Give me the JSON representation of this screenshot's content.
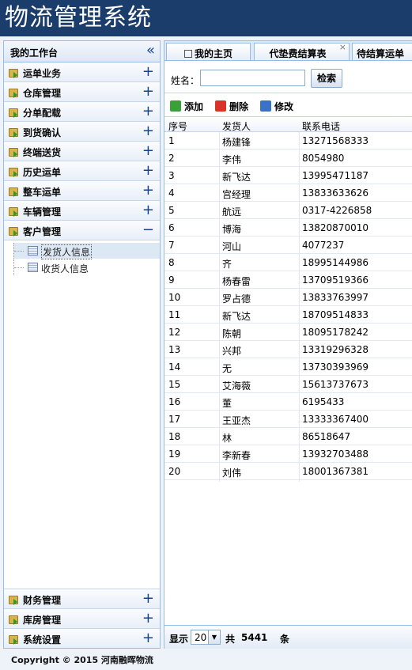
{
  "app": {
    "title": "物流管理系统"
  },
  "sidebar": {
    "header": "我的工作台",
    "collapse_glyph": "«",
    "items": [
      {
        "label": "运单业务",
        "toggle": "+"
      },
      {
        "label": "仓库管理",
        "toggle": "+"
      },
      {
        "label": "分单配载",
        "toggle": "+"
      },
      {
        "label": "到货确认",
        "toggle": "+"
      },
      {
        "label": "终端送货",
        "toggle": "+"
      },
      {
        "label": "历史运单",
        "toggle": "+"
      },
      {
        "label": "整车运单",
        "toggle": "+"
      },
      {
        "label": "车辆管理",
        "toggle": "+"
      },
      {
        "label": "客户管理",
        "toggle": "−"
      }
    ],
    "subitems": [
      {
        "label": "发货人信息",
        "selected": true
      },
      {
        "label": "收货人信息",
        "selected": false
      }
    ],
    "bottom_items": [
      {
        "label": "财务管理",
        "toggle": "+"
      },
      {
        "label": "库房管理",
        "toggle": "+"
      },
      {
        "label": "系统设置",
        "toggle": "+"
      }
    ]
  },
  "footer": {
    "text": "Copyright © 2015 河南融晖物流"
  },
  "tabs": [
    {
      "label": "我的主页",
      "icon": "home-icon"
    },
    {
      "label": "代垫费结算表",
      "close": "×"
    },
    {
      "label": "待结算运单"
    }
  ],
  "search": {
    "label": "姓名：",
    "value": "",
    "button": "检索"
  },
  "toolbar": {
    "add": "添加",
    "delete": "删除",
    "edit": "修改"
  },
  "grid": {
    "columns": [
      "序号",
      "发货人",
      "联系电话"
    ],
    "rows": [
      [
        "1",
        "杨建锋",
        "13271568333"
      ],
      [
        "2",
        "李伟",
        "8054980"
      ],
      [
        "3",
        "新飞达",
        "13995471187"
      ],
      [
        "4",
        "宫经理",
        "13833633626"
      ],
      [
        "5",
        "航远",
        "0317-4226858"
      ],
      [
        "6",
        "博海",
        "13820870010"
      ],
      [
        "7",
        "河山",
        "4077237"
      ],
      [
        "8",
        "齐",
        "18995144986"
      ],
      [
        "9",
        "杨春雷",
        "13709519366"
      ],
      [
        "10",
        "罗占德",
        "13833763997"
      ],
      [
        "11",
        "新飞达",
        "18709514833"
      ],
      [
        "12",
        "陈朝",
        "18095178242"
      ],
      [
        "13",
        "兴邦",
        "13319296328"
      ],
      [
        "14",
        "无",
        "13730393969"
      ],
      [
        "15",
        "艾海薇",
        "15613737673"
      ],
      [
        "16",
        "董",
        "6195433"
      ],
      [
        "17",
        "王亚杰",
        "13333367400"
      ],
      [
        "18",
        "林",
        "86518647"
      ],
      [
        "19",
        "李新春",
        "13932703488"
      ],
      [
        "20",
        "刘伟",
        "18001367381"
      ]
    ]
  },
  "pager": {
    "show_label": "显示",
    "page_size": "20",
    "total_prefix": "共",
    "total": "5441",
    "total_suffix": "条"
  },
  "colors": {
    "header_bg": "#1b3d6b",
    "border": "#99bbe8",
    "add_icon": "#3aa03a",
    "delete_icon": "#d9342b",
    "edit_icon": "#3c72c6"
  }
}
